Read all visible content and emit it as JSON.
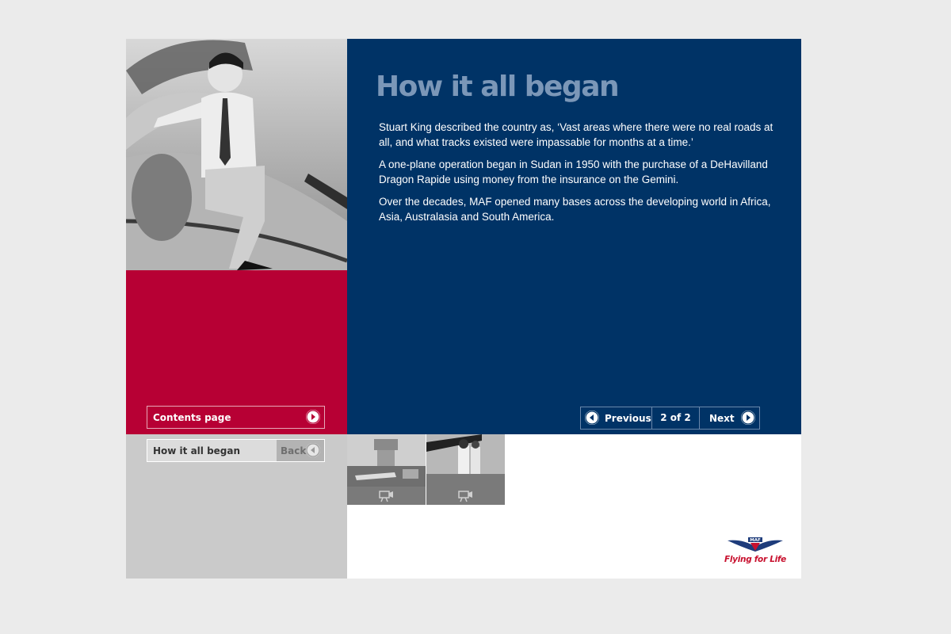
{
  "content": {
    "title": "How it all began",
    "paragraphs": [
      "Stuart King described the country as, ‘Vast areas where there were no real roads at all, and what tracks existed were impassable for months at a time.’",
      "A one-plane operation began in Sudan in 1950 with the purchase of a DeHavilland Dragon Rapide using money from the insurance on the Gemini.",
      "Over the decades, MAF opened many bases across the developing world in Africa, Asia, Australasia and South America."
    ]
  },
  "nav": {
    "contents_label": "Contents page",
    "breadcrumb_label": "How it all began",
    "back_label": "Back"
  },
  "pager": {
    "previous_label": "Previous",
    "count_label": "2 of 2",
    "next_label": "Next"
  },
  "thumbnails": [
    {
      "icon": "video-camera-icon"
    },
    {
      "icon": "video-camera-icon"
    }
  ],
  "logo": {
    "text": "MAF",
    "tagline": "Flying for Life"
  },
  "colors": {
    "blue": "#003366",
    "red": "#b70034",
    "title": "#7b97b8",
    "grey": "#cacaca"
  }
}
